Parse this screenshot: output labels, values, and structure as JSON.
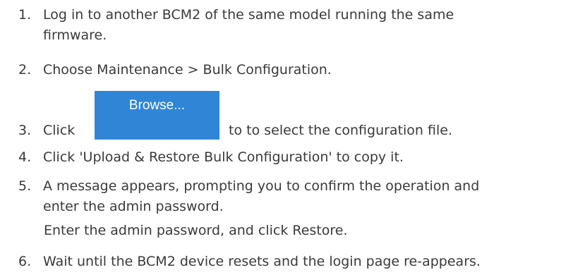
{
  "steps": [
    {
      "number": "1.",
      "lines": [
        "Log in to another BCM2 of the same model running the same",
        "firmware."
      ]
    },
    {
      "number": "2.",
      "lines": [
        "Choose Maintenance > Bulk Configuration."
      ]
    },
    {
      "number": "3.",
      "before": "Click",
      "button_label": "Browse...",
      "after": "to to select the configuration file."
    },
    {
      "number": "4.",
      "lines": [
        "Click 'Upload & Restore Bulk Configuration' to copy it."
      ]
    },
    {
      "number": "5.",
      "lines": [
        "A message appears, prompting you to confirm the operation and",
        "enter the admin password."
      ]
    },
    {
      "number": "6.",
      "lines": [
        "Wait until the BCM2 device resets and the login page re-appears."
      ]
    }
  ],
  "note": "Enter the admin password, and click Restore.",
  "colors": {
    "text": "#3a3a3a",
    "button_bg": "#2f86d6",
    "button_text": "#ffffff"
  }
}
